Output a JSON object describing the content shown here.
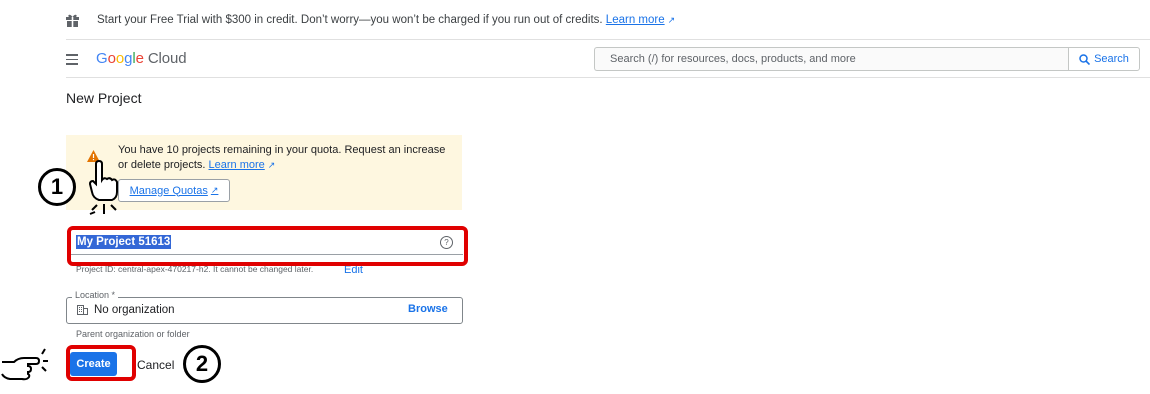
{
  "banner": {
    "text": "Start your Free Trial with $300 in credit. Don’t worry—you won’t be charged if you run out of credits.",
    "link": "Learn more",
    "icon": "gift-icon"
  },
  "header": {
    "logo_letters": [
      "G",
      "o",
      "o",
      "g",
      "l",
      "e"
    ],
    "logo_product": "Cloud",
    "search_placeholder": "Search (/) for resources, docs, products, and more",
    "search_button": "Search"
  },
  "page": {
    "title": "New Project"
  },
  "alert": {
    "message": "You have 10 projects remaining in your quota. Request an increase or delete projects.",
    "link": "Learn more",
    "button": "Manage Quotas"
  },
  "project_name": {
    "value": "My Project 51613",
    "help_fragment": "Project ID: central-apex-470217-h2. It cannot be changed later.",
    "edit": "Edit"
  },
  "location": {
    "label": "Location *",
    "value": "No organization",
    "browse": "Browse",
    "help": "Parent organization or folder"
  },
  "actions": {
    "create": "Create",
    "cancel": "Cancel"
  },
  "annotations": {
    "step1": "1",
    "step2": "2",
    "highlight_color": "#e00000"
  },
  "colors": {
    "primary": "#1a73e8",
    "alert_bg": "#fef7e0",
    "selection": "#3367d6"
  }
}
